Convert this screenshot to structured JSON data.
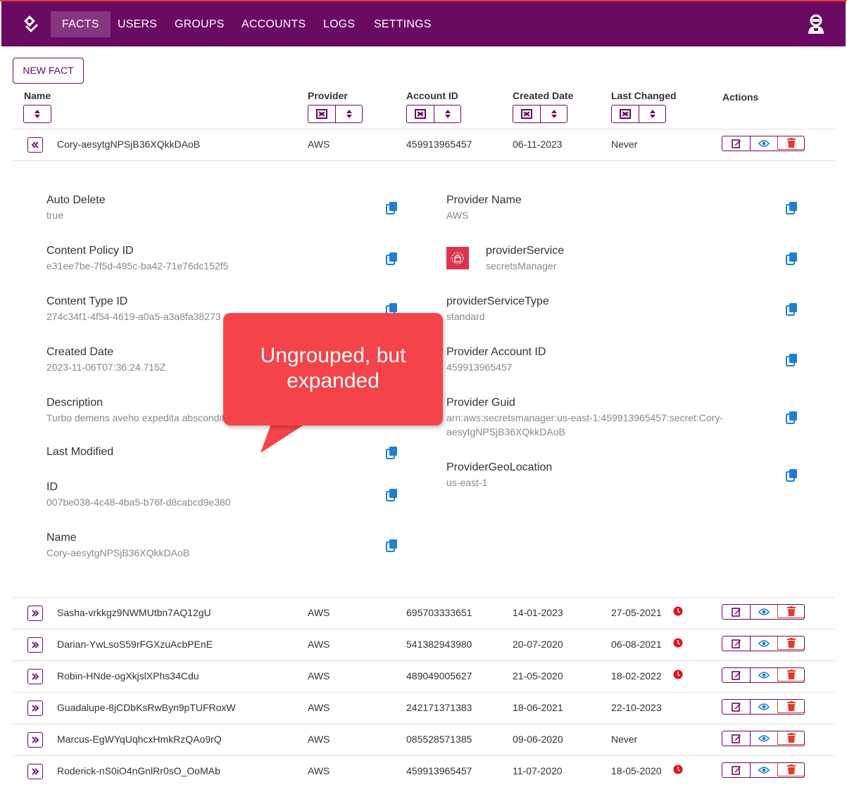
{
  "nav": {
    "items": [
      "FACTS",
      "USERS",
      "GROUPS",
      "ACCOUNTS",
      "LOGS",
      "SETTINGS"
    ],
    "active": "FACTS"
  },
  "toolbar": {
    "new_fact_label": "NEW FACT"
  },
  "table": {
    "headers": {
      "name": "Name",
      "provider": "Provider",
      "account_id": "Account ID",
      "created_date": "Created Date",
      "last_changed": "Last Changed",
      "actions": "Actions"
    },
    "expanded_row": {
      "name": "Cory-aesytgNPSjB36XQkkDAoB",
      "provider": "AWS",
      "account_id": "459913965457",
      "created_date": "06-11-2023",
      "last_changed": "Never"
    },
    "rows": [
      {
        "name": "Sasha-vrkkgz9NWMUtbn7AQ12gU",
        "provider": "AWS",
        "account_id": "695703333651",
        "created_date": "14-01-2023",
        "last_changed": "27-05-2021",
        "stale": true
      },
      {
        "name": "Darian-YwLsoS59rFGXzuAcbPEnE",
        "provider": "AWS",
        "account_id": "541382943980",
        "created_date": "20-07-2020",
        "last_changed": "06-08-2021",
        "stale": true
      },
      {
        "name": "Robin-HNde-ogXkjslXPhs34Cdu",
        "provider": "AWS",
        "account_id": "489049005627",
        "created_date": "21-05-2020",
        "last_changed": "18-02-2022",
        "stale": true
      },
      {
        "name": "Guadalupe-8jCDbKsRwByn9pTUFRoxW",
        "provider": "AWS",
        "account_id": "242171371383",
        "created_date": "18-06-2021",
        "last_changed": "22-10-2023",
        "stale": false
      },
      {
        "name": "Marcus-EgWYqUqhcxHmkRzQAo9rQ",
        "provider": "AWS",
        "account_id": "085528571385",
        "created_date": "09-06-2020",
        "last_changed": "Never",
        "stale": false
      },
      {
        "name": "Roderick-nS0iO4nGnlRr0sO_OoMAb",
        "provider": "AWS",
        "account_id": "459913965457",
        "created_date": "11-07-2020",
        "last_changed": "18-05-2020",
        "stale": true
      }
    ]
  },
  "details": {
    "left": [
      {
        "label": "Auto Delete",
        "value": "true"
      },
      {
        "label": "Content Policy ID",
        "value": "e31ee7be-7f5d-495c-ba42-71e76dc152f5"
      },
      {
        "label": "Content Type ID",
        "value": "274c34f1-4f54-4619-a0a5-a3a8fa38273"
      },
      {
        "label": "Created Date",
        "value": "2023-11-06T07:36:24.715Z"
      },
      {
        "label": "Description",
        "value": "Turbo demens aveho expedita abscondit"
      },
      {
        "label": "Last Modified",
        "value": ""
      },
      {
        "label": "ID",
        "value": "007be038-4c48-4ba5-b76f-d8cabcd9e380"
      },
      {
        "label": "Name",
        "value": "Cory-aesytgNPSjB36XQkkDAoB"
      }
    ],
    "right": [
      {
        "label": "Provider Name",
        "value": "AWS"
      },
      {
        "label": "providerService",
        "value": "secretsManager"
      },
      {
        "label": "providerServiceType",
        "value": "standard"
      },
      {
        "label": "Provider Account ID",
        "value": "459913965457"
      },
      {
        "label": "Provider Guid",
        "value": "arn:aws:secretsmanager:us-east-1:459913965457:secret:Cory-",
        "value2": "aesytgNPSjB36XQkkDAoB"
      },
      {
        "label": "ProviderGeoLocation",
        "value": "us-east-1"
      }
    ]
  },
  "callout": {
    "line1": "Ungrouped, but",
    "line2": "expanded"
  },
  "colors": {
    "brand": "#6a0a63",
    "danger": "#e23a2b",
    "copy": "#1f7fd1",
    "view": "#1a7fc9",
    "service_badge": "#dd344c"
  },
  "icons": [
    "app-logo-icon",
    "user-avatar-icon",
    "sort-icon",
    "group-icon",
    "collapse-icon",
    "expand-icon",
    "edit-icon",
    "eye-icon",
    "trash-icon",
    "copy-icon",
    "clock-icon",
    "secrets-manager-icon"
  ]
}
